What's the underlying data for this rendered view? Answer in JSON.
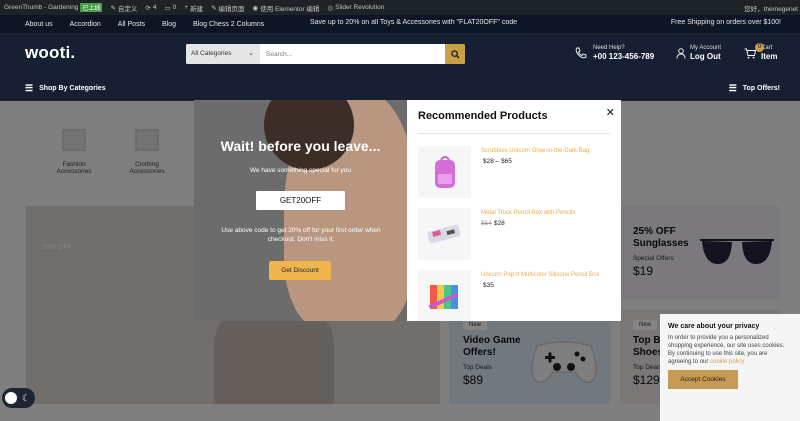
{
  "adminbar": {
    "site": "GreenThumb - Gardening",
    "badge": "已上线",
    "customize": "自定义",
    "updates": "4",
    "comments": "0",
    "new": "新建",
    "edit_page": "编辑页面",
    "elementor": "使用 Elementor 编辑",
    "slider": "Slider Revolution",
    "greeting": "您好，themegenet"
  },
  "topbar": {
    "links": [
      "About us",
      "Accordion",
      "All Posts",
      "Blog",
      "Blog Chess 2 Columns"
    ],
    "promo": "Save up to 20% on all Toys & Accessories with \"FLAT20OFF\" code",
    "shipping": "Free Shipping on orders over $100!"
  },
  "header": {
    "logo": "wooti.",
    "search_category": "All Categories",
    "search_placeholder": "Search...",
    "help_label": "Need Help?",
    "help_phone": "+00 123-456-789",
    "account_label": "My Account",
    "account_action": "Log Out",
    "cart_count": "0",
    "cart_label": "Cart",
    "cart_item": "Item"
  },
  "navbar": {
    "categories": "Shop By Categories",
    "top_offers": "Top Offers!"
  },
  "categories": [
    {
      "line1": "Fashion",
      "line2": "Accessories"
    },
    {
      "line1": "Clothing",
      "line2": "Accessories"
    }
  ],
  "hero": {
    "label": "20% OFF"
  },
  "promos": [
    {
      "new": "",
      "title_l1": "25% OFF",
      "title_l2": "Sunglasses",
      "sub": "Special Offers",
      "price": "$19"
    },
    {
      "new": "New",
      "title_l1": "Video Game",
      "title_l2": "Offers!",
      "sub": "Top Deals",
      "price": "$89"
    },
    {
      "new": "New",
      "title_l1": "Top B",
      "title_l2": "Shoes",
      "sub": "Top Deals",
      "price": "$129"
    }
  ],
  "popup": {
    "title": "Wait! before you leave...",
    "desc": "We have something special for you",
    "code": "GET20OFF",
    "note": "Use above code to get 20% off for your first order when checkout. Don't miss it.",
    "button": "Get Discount",
    "right_title": "Recommended Products",
    "close": "✕",
    "products": [
      {
        "name": "Scrubbies Unicorn Glow-in-the-Dark Bag",
        "old": "",
        "price": "$28 – $65"
      },
      {
        "name": "Metal Truck Pencil Box with Pencils",
        "old": "$54",
        "price": "$28"
      },
      {
        "name": "Unicorn Pop-It Multicolor Silicone Pencil Box",
        "old": "",
        "price": "$35"
      }
    ]
  },
  "cookie": {
    "title": "We care about your privacy",
    "body": "In order to provide you a personalized shopping experience, our site uses cookies. By continuing to use this site, you are agreeing to our",
    "link": "cookie policy",
    "button": "Accept Cookies"
  },
  "colors": {
    "accent": "#f0b54d",
    "header": "#172033",
    "topbar": "#0e1626"
  }
}
